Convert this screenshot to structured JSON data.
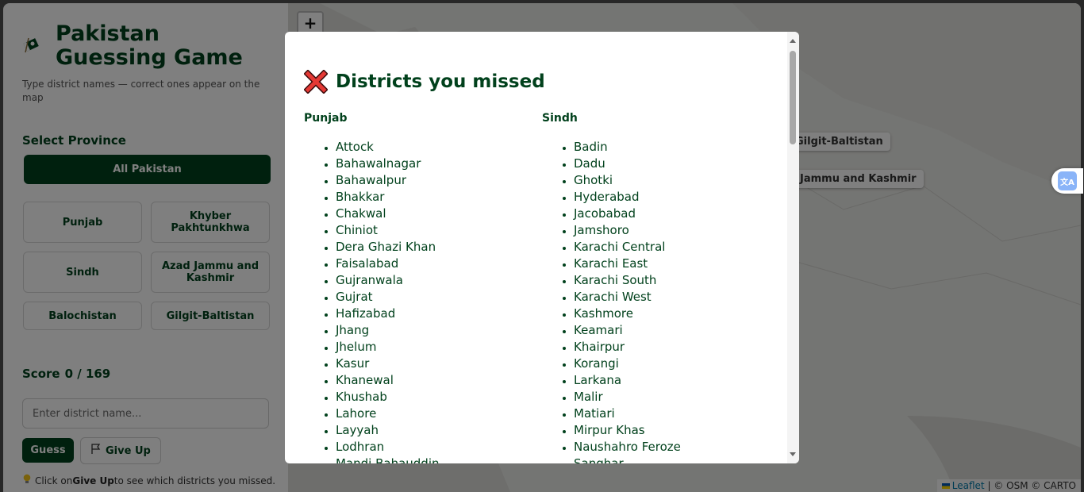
{
  "app": {
    "title": "Pakistan Guessing Game",
    "subtitle": "Type district names — correct ones appear on the map"
  },
  "sidebar": {
    "select_label": "Select Province",
    "all_button": "All Pakistan",
    "provinces": [
      "Punjab",
      "Khyber Pakhtunkhwa",
      "Sindh",
      "Azad Jammu and Kashmir",
      "Balochistan",
      "Gilgit-Baltistan"
    ],
    "score_label": "Score",
    "score_value": "0 / 169",
    "input_placeholder": "Enter district name...",
    "guess_label": "Guess",
    "giveup_label": "Give Up",
    "hint": {
      "pre": "Click on ",
      "bold": "Give Up",
      "post": " to see which districts you missed."
    }
  },
  "map": {
    "zoom_in": "+",
    "labels": [
      "Gilgit-Baltistan",
      "Jammu and Kashmir"
    ],
    "attribution": {
      "leaflet": "Leaflet",
      "rest": "| © OSM © CARTO"
    }
  },
  "modal": {
    "title": "Districts you missed",
    "columns": [
      {
        "heading": "Punjab",
        "items": [
          "Attock",
          "Bahawalnagar",
          "Bahawalpur",
          "Bhakkar",
          "Chakwal",
          "Chiniot",
          "Dera Ghazi Khan",
          "Faisalabad",
          "Gujranwala",
          "Gujrat",
          "Hafizabad",
          "Jhang",
          "Jhelum",
          "Kasur",
          "Khanewal",
          "Khushab",
          "Lahore",
          "Layyah",
          "Lodhran",
          "Mandi Bahauddin"
        ]
      },
      {
        "heading": "Sindh",
        "items": [
          "Badin",
          "Dadu",
          "Ghotki",
          "Hyderabad",
          "Jacobabad",
          "Jamshoro",
          "Karachi Central",
          "Karachi East",
          "Karachi South",
          "Karachi West",
          "Kashmore",
          "Keamari",
          "Khairpur",
          "Korangi",
          "Larkana",
          "Malir",
          "Matiari",
          "Mirpur Khas",
          "Naushahro Feroze",
          "Sanghar"
        ]
      }
    ]
  },
  "colors": {
    "brand": "#01411c",
    "overlay": "rgba(0,0,0,0.5)",
    "close_red": "#e53935"
  },
  "icons": {
    "title": "flag-icon",
    "modal": "close-x-icon",
    "giveup": "flag-outline-icon",
    "hint": "lightbulb-icon",
    "translate": "translate-icon"
  }
}
